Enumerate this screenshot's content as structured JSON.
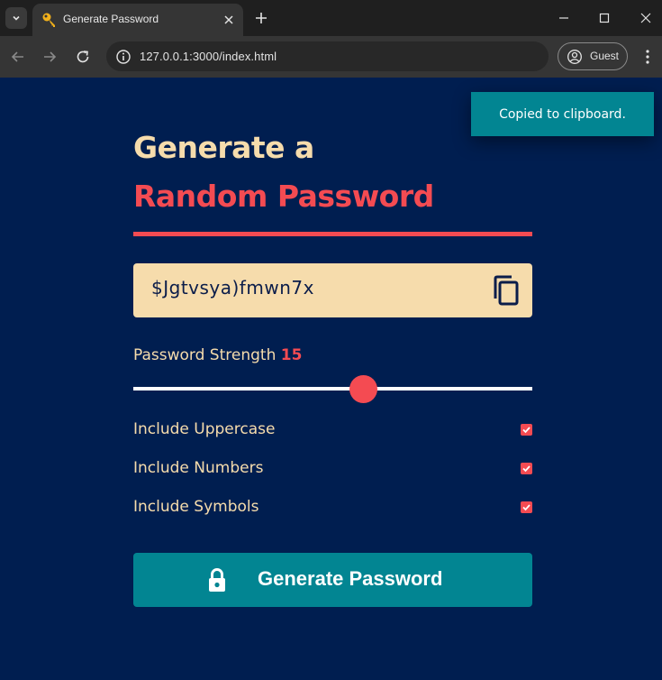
{
  "browser": {
    "tab_title": "Generate Password",
    "url": "127.0.0.1:3000/index.html",
    "profile_label": "Guest"
  },
  "toast": {
    "message": "Copied to clipboard."
  },
  "heading": {
    "line1": "Generate a",
    "line2": "Random Password"
  },
  "password": {
    "value": "$Jgtvsya)fmwn7x"
  },
  "strength": {
    "label": "Password Strength",
    "value": "15"
  },
  "options": [
    {
      "label": "Include Uppercase",
      "checked": true
    },
    {
      "label": "Include Numbers",
      "checked": true
    },
    {
      "label": "Include Symbols",
      "checked": true
    }
  ],
  "generate_button": {
    "label": "Generate Password"
  },
  "colors": {
    "background": "#001e50",
    "accent_red": "#f44b52",
    "cream": "#f6dcac",
    "teal": "#028592"
  },
  "icons": {
    "tab_favicon": "key-icon",
    "copy": "copy-icon",
    "generate": "lock-icon"
  }
}
